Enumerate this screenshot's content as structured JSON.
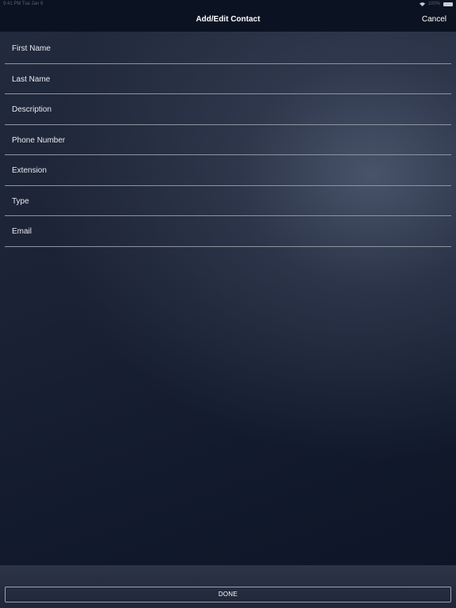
{
  "status_bar": {
    "left_text": "9:41 PM  Tue Jan 9",
    "right_text": "100%"
  },
  "nav": {
    "title": "Add/Edit Contact",
    "cancel_label": "Cancel"
  },
  "fields": [
    {
      "placeholder": "First Name",
      "value": ""
    },
    {
      "placeholder": "Last Name",
      "value": ""
    },
    {
      "placeholder": "Description",
      "value": ""
    },
    {
      "placeholder": "Phone Number",
      "value": ""
    },
    {
      "placeholder": "Extension",
      "value": ""
    },
    {
      "placeholder": "Type",
      "value": ""
    },
    {
      "placeholder": "Email",
      "value": ""
    }
  ],
  "footer": {
    "done_label": "DONE"
  },
  "icons": {
    "wifi": "wifi-icon",
    "battery": "battery-icon"
  },
  "colors": {
    "nav_background": "#0b1222",
    "divider": "#8e94a0",
    "text": "#ffffff"
  }
}
